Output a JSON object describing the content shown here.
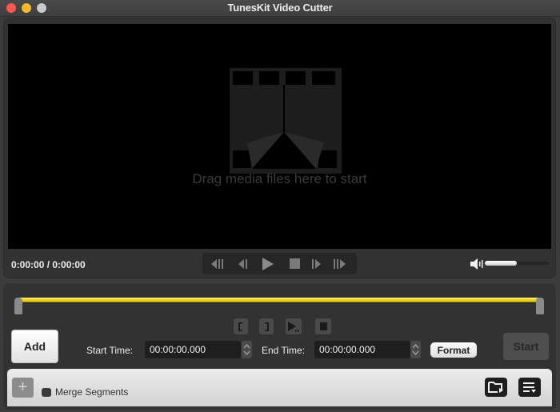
{
  "window": {
    "title": "TunesKit Video Cutter",
    "controls": [
      "close",
      "minimize",
      "maximize"
    ]
  },
  "player": {
    "placeholder_icon": "film-strip-icon",
    "drag_hint": "Drag media files here to start",
    "timecode": "0:00:00 / 0:00:00",
    "transport": [
      {
        "name": "previous-segment-button",
        "icon": "skip-back-icon"
      },
      {
        "name": "previous-frame-button",
        "icon": "step-back-icon"
      },
      {
        "name": "play-button",
        "icon": "play-icon"
      },
      {
        "name": "stop-button",
        "icon": "stop-icon"
      },
      {
        "name": "next-frame-button",
        "icon": "step-forward-icon"
      },
      {
        "name": "next-segment-button",
        "icon": "skip-forward-icon"
      }
    ],
    "volume": {
      "icon": "speaker-icon",
      "level_percent": 50
    }
  },
  "editor": {
    "timeline_color": "#e8cc12",
    "segment_controls": [
      {
        "name": "set-start-button",
        "icon": "bracket-left-icon"
      },
      {
        "name": "set-end-button",
        "icon": "bracket-right-icon"
      },
      {
        "name": "preview-segment-button",
        "icon": "play-segment-icon"
      },
      {
        "name": "stop-segment-button",
        "icon": "stop-icon"
      }
    ],
    "add_label": "Add",
    "start_time_label": "Start Time:",
    "start_time_value": "00:00:00.000",
    "end_time_label": "End Time:",
    "end_time_value": "00:00:00.000",
    "format_label": "Format",
    "start_label": "Start"
  },
  "segments_bar": {
    "add_icon": "plus-icon",
    "merge_label": "Merge Segments",
    "merge_checked": false,
    "output_folder_icon": "folder-icon",
    "list_icon": "list-icon"
  }
}
